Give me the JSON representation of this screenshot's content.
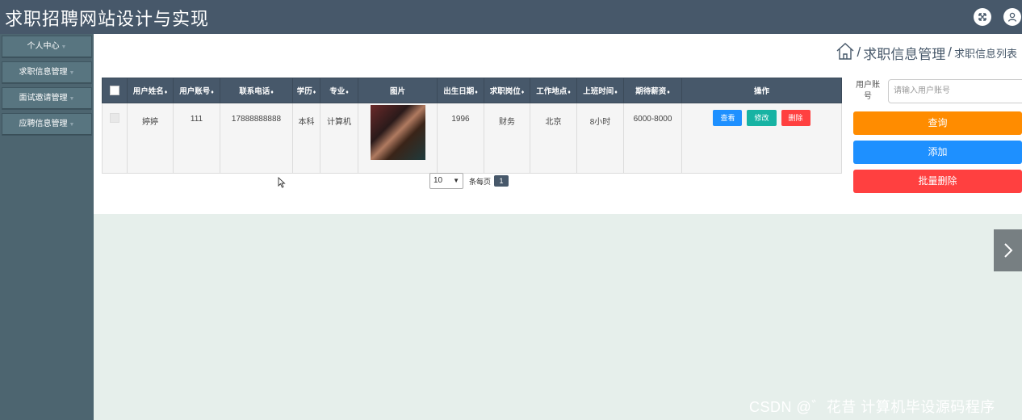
{
  "app": {
    "title": "求职招聘网站设计与实现"
  },
  "sidebar": {
    "items": [
      {
        "label": "个人中心"
      },
      {
        "label": "求职信息管理"
      },
      {
        "label": "面试邀请管理"
      },
      {
        "label": "应聘信息管理"
      }
    ]
  },
  "breadcrumb": {
    "section": "求职信息管理",
    "separator": "/",
    "page": "求职信息列表"
  },
  "table": {
    "columns": [
      "用户姓名",
      "用户账号",
      "联系电话",
      "学历",
      "专业",
      "图片",
      "出生日期",
      "求职岗位",
      "工作地点",
      "上班时间",
      "期待薪资",
      "操作"
    ],
    "rows": [
      {
        "name": "婷婷",
        "account": "111",
        "phone": "17888888888",
        "education": "本科",
        "major": "计算机",
        "birth": "1996",
        "position": "财务",
        "location": "北京",
        "hours": "8小时",
        "salary": "6000-8000",
        "actions": {
          "view": "查看",
          "edit": "修改",
          "delete": "删除"
        }
      }
    ]
  },
  "pagination": {
    "page_size": "10",
    "per_page_label": "条每页",
    "current_page": "1"
  },
  "filter": {
    "label": "用户账号",
    "placeholder": "请输入用户账号",
    "search_label": "查询",
    "add_label": "添加",
    "batch_delete_label": "批量删除"
  },
  "watermark": "CSDN @゛花昔 计算机毕设源码程序",
  "colors": {
    "topbar": "#47586a",
    "sidebar": "#4d6570",
    "search": "#ff8c00",
    "add": "#1e90ff",
    "delete": "#ff4040",
    "view": "#1e90ff",
    "edit": "#17b3a3"
  }
}
